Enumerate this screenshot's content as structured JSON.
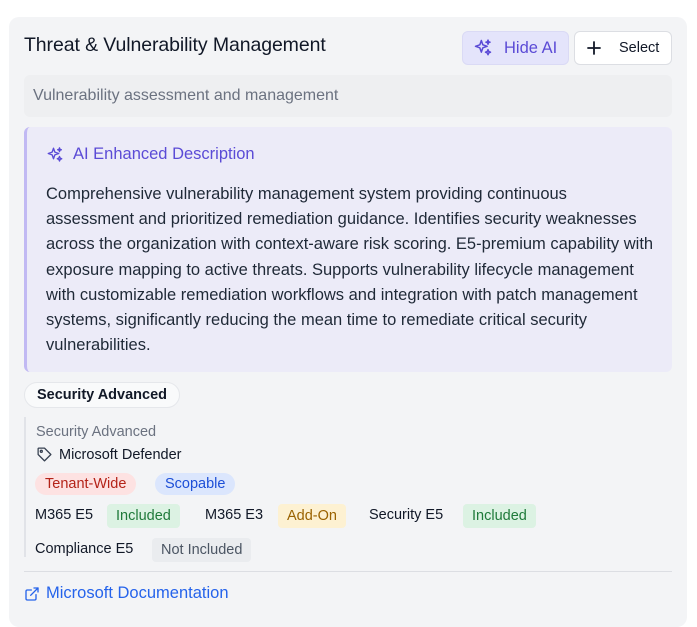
{
  "header": {
    "title": "Threat & Vulnerability Management",
    "hide_ai_label": "Hide AI",
    "select_label": "Select"
  },
  "subtitle": "Vulnerability assessment and management",
  "ai": {
    "heading": "AI Enhanced Description",
    "text": "Comprehensive vulnerability management system providing continuous assessment and prioritized remediation guidance. Identifies security weaknesses across the organization with context-aware risk scoring. E5-premium capability with exposure mapping to active threats. Supports vulnerability lifecycle management with customizable remediation workflows and integration with patch management systems, significantly reducing the mean time to remediate critical security vulnerabilities."
  },
  "category_pill": "Security Advanced",
  "details": {
    "category": "Security Advanced",
    "vendor": "Microsoft Defender",
    "scope_badges": [
      "Tenant-Wide",
      "Scopable"
    ]
  },
  "licenses": [
    {
      "name": "M365 E5",
      "status": "Included"
    },
    {
      "name": "M365 E3",
      "status": "Add-On"
    },
    {
      "name": "Security E5",
      "status": "Included"
    },
    {
      "name": "Compliance E5",
      "status": "Not Included"
    }
  ],
  "doc_link": "Microsoft Documentation",
  "colors": {
    "accent": "#5b4bd6",
    "link": "#2563eb",
    "included": "#1f7a3a",
    "addon": "#9a6200",
    "tenant": "#b42318",
    "scope": "#1d4fd7"
  },
  "icons": {
    "hide_ai": "sparkles-icon",
    "select": "plus-icon",
    "ai_heading": "sparkles-icon",
    "vendor": "tag-icon",
    "doc_link": "external-link-icon"
  }
}
